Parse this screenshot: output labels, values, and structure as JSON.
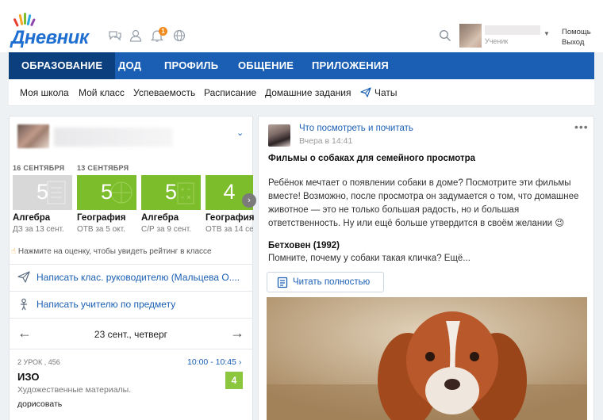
{
  "header": {
    "logo_text": "Дневник",
    "notification_count": "1",
    "user": {
      "role": "Ученик"
    },
    "help": "Помощь",
    "exit": "Выход"
  },
  "main_nav": [
    {
      "label": "Образование",
      "active": false
    },
    {
      "label": "ДОД",
      "active": true
    },
    {
      "label": "Профиль",
      "active": false
    },
    {
      "label": "Общение",
      "active": false
    },
    {
      "label": "Приложения",
      "active": false
    }
  ],
  "sub_nav": [
    "Моя школа",
    "Мой класс",
    "Успеваемость",
    "Расписание",
    "Домашние задания",
    "Чаты"
  ],
  "grades": {
    "dates": [
      "16 СЕНТЯБРЯ",
      "13 СЕНТЯБРЯ"
    ],
    "items": [
      {
        "value": "5",
        "subject": "Алгебра",
        "note": "ДЗ за 13 сент.",
        "color": "#d8d8d8"
      },
      {
        "value": "5",
        "subject": "География",
        "note": "ОТВ за 5 окт.",
        "color": "#7cbd2b"
      },
      {
        "value": "5",
        "subject": "Алгебра",
        "note": "С/Р за 9 сент.",
        "color": "#7cbd2b"
      },
      {
        "value": "4",
        "subject": "География",
        "note": "ОТВ за 14 сент",
        "color": "#7cbd2b"
      }
    ],
    "hint": "Нажмите на оценку, чтобы увидеть рейтинг в классе"
  },
  "links": {
    "class_teacher": "Написать клас. руководителю (Мальцева О....",
    "subject_teacher": "Написать учителю по предмету"
  },
  "schedule": {
    "day": "23 сент., четверг",
    "lesson": {
      "number": "2 УРОК , 456",
      "time": "10:00 - 10:45",
      "name": "ИЗО",
      "topic": "Художественные материалы.",
      "homework": "дорисовать",
      "grade": "4"
    }
  },
  "post": {
    "author": "Что посмотреть и почитать",
    "time": "Вчера в 14:41",
    "title": "Фильмы о собаках для семейного просмотра",
    "body": "Ребёнок мечтает о появлении собаки в доме? Посмотрите эти фильмы вместе! Возможно, после просмотра он задумается о том, что домашнее животное — это не только большая радость, но и большая ответственность. Ну или ещё больше утвердится в своём желании 😉",
    "sub_title": "Бетховен (1992)",
    "sub_text": "Помните, почему у собаки такая кличка? Ещё...",
    "read_more": "Читать полностью",
    "more": "•••"
  }
}
